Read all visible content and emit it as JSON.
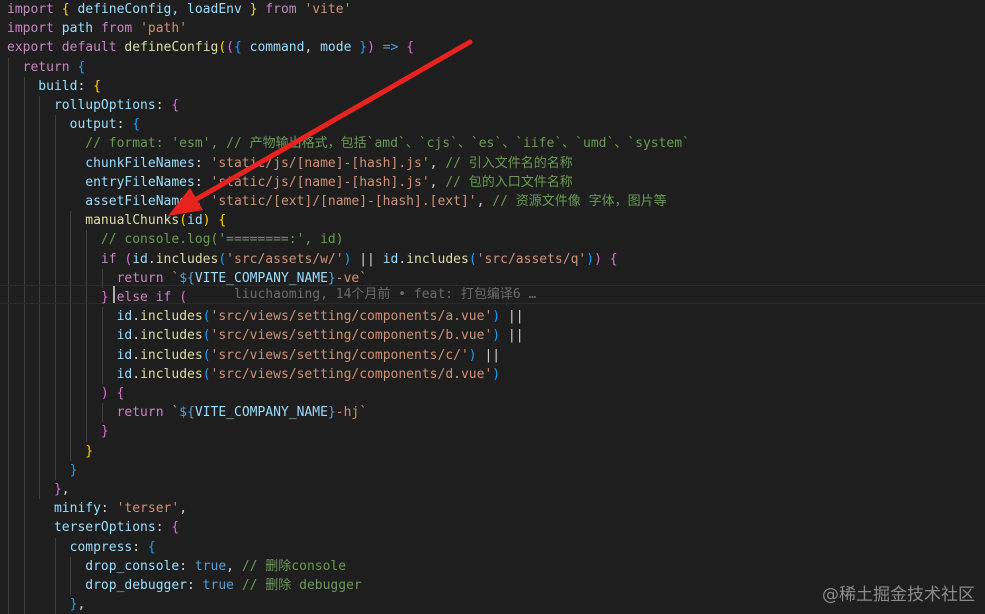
{
  "code": {
    "lines": [
      [
        [
          "import",
          "tok-kw"
        ],
        [
          " ",
          "tok-pl"
        ],
        [
          "{",
          "tok-br1"
        ],
        [
          " defineConfig, loadEnv ",
          "tok-var"
        ],
        [
          "}",
          "tok-br1"
        ],
        [
          " from ",
          "tok-kw"
        ],
        [
          "'vite'",
          "tok-str"
        ]
      ],
      [
        [
          "import",
          "tok-kw"
        ],
        [
          " path ",
          "tok-var"
        ],
        [
          "from",
          "tok-kw"
        ],
        [
          " ",
          "tok-pl"
        ],
        [
          "'path'",
          "tok-str"
        ]
      ],
      [
        [
          "export",
          "tok-kw"
        ],
        [
          " ",
          "tok-pl"
        ],
        [
          "default",
          "tok-kw"
        ],
        [
          " ",
          "tok-pl"
        ],
        [
          "defineConfig",
          "tok-fn"
        ],
        [
          "(",
          "tok-br1"
        ],
        [
          "(",
          "tok-br2"
        ],
        [
          "{",
          "tok-br3"
        ],
        [
          " command",
          "tok-var"
        ],
        [
          ", ",
          "tok-pl"
        ],
        [
          "mode",
          "tok-var"
        ],
        [
          " ",
          "tok-pl"
        ],
        [
          "}",
          "tok-br3"
        ],
        [
          ")",
          "tok-br2"
        ],
        [
          " ",
          "tok-pl"
        ],
        [
          "=>",
          "tok-kwb"
        ],
        [
          " ",
          "tok-pl"
        ],
        [
          "{",
          "tok-br2"
        ]
      ],
      [
        [
          "  return",
          "tok-kw"
        ],
        [
          " ",
          "tok-pl"
        ],
        [
          "{",
          "tok-br3"
        ]
      ],
      [
        [
          "    build",
          "tok-var"
        ],
        [
          ": ",
          "tok-pl"
        ],
        [
          "{",
          "tok-br1"
        ]
      ],
      [
        [
          "      rollupOptions",
          "tok-var"
        ],
        [
          ": ",
          "tok-pl"
        ],
        [
          "{",
          "tok-br2"
        ]
      ],
      [
        [
          "        output",
          "tok-var"
        ],
        [
          ": ",
          "tok-pl"
        ],
        [
          "{",
          "tok-br3"
        ]
      ],
      [
        [
          "          // format: 'esm', // 产物输出格式，包括`amd`、`cjs`、`es`、`iife`、`umd`、`system`",
          "tok-cm"
        ]
      ],
      [
        [
          "          chunkFileNames",
          "tok-var"
        ],
        [
          ": ",
          "tok-pl"
        ],
        [
          "'static/js/[name]-[hash].js'",
          "tok-str"
        ],
        [
          ", ",
          "tok-pl"
        ],
        [
          "// 引入文件名的名称",
          "tok-cm"
        ]
      ],
      [
        [
          "          entryFileNames",
          "tok-var"
        ],
        [
          ": ",
          "tok-pl"
        ],
        [
          "'static/js/[name]-[hash].js'",
          "tok-str"
        ],
        [
          ", ",
          "tok-pl"
        ],
        [
          "// 包的入口文件名称",
          "tok-cm"
        ]
      ],
      [
        [
          "          assetFileNames",
          "tok-var"
        ],
        [
          ": ",
          "tok-pl"
        ],
        [
          "'static/[ext]/[name]-[hash].[ext]'",
          "tok-str"
        ],
        [
          ", ",
          "tok-pl"
        ],
        [
          "// 资源文件像 字体，图片等",
          "tok-cm"
        ]
      ],
      [
        [
          "          manualChunks",
          "tok-fn"
        ],
        [
          "(",
          "tok-br1"
        ],
        [
          "id",
          "tok-var"
        ],
        [
          ")",
          "tok-br1"
        ],
        [
          " ",
          "tok-pl"
        ],
        [
          "{",
          "tok-br1"
        ]
      ],
      [
        [
          "            // console.log('========:', id)",
          "tok-cm"
        ]
      ],
      [
        [
          "            if",
          "tok-kw"
        ],
        [
          " ",
          "tok-pl"
        ],
        [
          "(",
          "tok-br2"
        ],
        [
          "id",
          "tok-var"
        ],
        [
          ".",
          "tok-pl"
        ],
        [
          "includes",
          "tok-fn"
        ],
        [
          "(",
          "tok-br3"
        ],
        [
          "'src/assets/w/'",
          "tok-str"
        ],
        [
          ")",
          "tok-br3"
        ],
        [
          " || ",
          "tok-pl"
        ],
        [
          "id",
          "tok-var"
        ],
        [
          ".",
          "tok-pl"
        ],
        [
          "includes",
          "tok-fn"
        ],
        [
          "(",
          "tok-br3"
        ],
        [
          "'src/assets/q'",
          "tok-str"
        ],
        [
          ")",
          "tok-br3"
        ],
        [
          ")",
          "tok-br2"
        ],
        [
          " ",
          "tok-pl"
        ],
        [
          "{",
          "tok-br2"
        ]
      ],
      [
        [
          "              return",
          "tok-kw"
        ],
        [
          " ",
          "tok-pl"
        ],
        [
          "`",
          "tok-str"
        ],
        [
          "${",
          "tok-kwb"
        ],
        [
          "VITE_COMPANY_NAME",
          "tok-var"
        ],
        [
          "}",
          "tok-kwb"
        ],
        [
          "-ve`",
          "tok-str"
        ]
      ],
      [
        [
          "            ",
          "tok-pl"
        ],
        [
          "}",
          "tok-br2"
        ],
        [
          " else if",
          "tok-kw"
        ],
        [
          " ",
          "tok-pl"
        ],
        [
          "(",
          "tok-br2"
        ]
      ],
      [
        [
          "              id",
          "tok-var"
        ],
        [
          ".",
          "tok-pl"
        ],
        [
          "includes",
          "tok-fn"
        ],
        [
          "(",
          "tok-br3"
        ],
        [
          "'src/views/setting/components/a.vue'",
          "tok-str"
        ],
        [
          ")",
          "tok-br3"
        ],
        [
          " ||",
          "tok-pl"
        ]
      ],
      [
        [
          "              id",
          "tok-var"
        ],
        [
          ".",
          "tok-pl"
        ],
        [
          "includes",
          "tok-fn"
        ],
        [
          "(",
          "tok-br3"
        ],
        [
          "'src/views/setting/components/b.vue'",
          "tok-str"
        ],
        [
          ")",
          "tok-br3"
        ],
        [
          " ||",
          "tok-pl"
        ]
      ],
      [
        [
          "              id",
          "tok-var"
        ],
        [
          ".",
          "tok-pl"
        ],
        [
          "includes",
          "tok-fn"
        ],
        [
          "(",
          "tok-br3"
        ],
        [
          "'src/views/setting/components/c/'",
          "tok-str"
        ],
        [
          ")",
          "tok-br3"
        ],
        [
          " ||",
          "tok-pl"
        ]
      ],
      [
        [
          "              id",
          "tok-var"
        ],
        [
          ".",
          "tok-pl"
        ],
        [
          "includes",
          "tok-fn"
        ],
        [
          "(",
          "tok-br3"
        ],
        [
          "'src/views/setting/components/d.vue'",
          "tok-str"
        ],
        [
          ")",
          "tok-br3"
        ]
      ],
      [
        [
          "            ",
          "tok-pl"
        ],
        [
          ")",
          "tok-br2"
        ],
        [
          " ",
          "tok-pl"
        ],
        [
          "{",
          "tok-br2"
        ]
      ],
      [
        [
          "              return",
          "tok-kw"
        ],
        [
          " ",
          "tok-pl"
        ],
        [
          "`",
          "tok-str"
        ],
        [
          "${",
          "tok-kwb"
        ],
        [
          "VITE_COMPANY_NAME",
          "tok-var"
        ],
        [
          "}",
          "tok-kwb"
        ],
        [
          "-hj`",
          "tok-str"
        ]
      ],
      [
        [
          "            ",
          "tok-pl"
        ],
        [
          "}",
          "tok-br2"
        ]
      ],
      [
        [
          "          ",
          "tok-pl"
        ],
        [
          "}",
          "tok-br1"
        ]
      ],
      [
        [
          "        ",
          "tok-pl"
        ],
        [
          "}",
          "tok-br3"
        ]
      ],
      [
        [
          "      ",
          "tok-pl"
        ],
        [
          "}",
          "tok-br2"
        ],
        [
          ",",
          "tok-pl"
        ]
      ],
      [
        [
          "      minify",
          "tok-var"
        ],
        [
          ": ",
          "tok-pl"
        ],
        [
          "'terser'",
          "tok-str"
        ],
        [
          ",",
          "tok-pl"
        ]
      ],
      [
        [
          "      terserOptions",
          "tok-var"
        ],
        [
          ": ",
          "tok-pl"
        ],
        [
          "{",
          "tok-br2"
        ]
      ],
      [
        [
          "        compress",
          "tok-var"
        ],
        [
          ": ",
          "tok-pl"
        ],
        [
          "{",
          "tok-br3"
        ]
      ],
      [
        [
          "          drop_console",
          "tok-var"
        ],
        [
          ": ",
          "tok-pl"
        ],
        [
          "true",
          "tok-kwb"
        ],
        [
          ", ",
          "tok-pl"
        ],
        [
          "// 删除console",
          "tok-cm"
        ]
      ],
      [
        [
          "          drop_debugger",
          "tok-var"
        ],
        [
          ": ",
          "tok-pl"
        ],
        [
          "true",
          "tok-kwb"
        ],
        [
          " ",
          "tok-pl"
        ],
        [
          "// 删除 debugger",
          "tok-cm"
        ]
      ],
      [
        [
          "        ",
          "tok-pl"
        ],
        [
          "}",
          "tok-br3"
        ],
        [
          ",",
          "tok-pl"
        ]
      ]
    ]
  },
  "blame": "liuchaoming, 14个月前 • feat: 打包编译6 …",
  "watermark": "@稀土掘金技术社区",
  "colors": {
    "background": "#1e1e1e",
    "annotation_arrow": "#e8231f"
  }
}
